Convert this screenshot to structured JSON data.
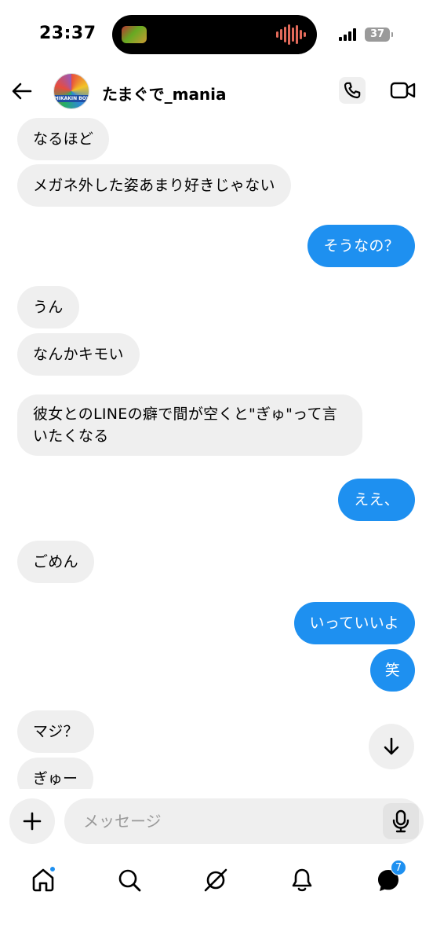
{
  "status_bar": {
    "time": "23:37",
    "battery": "37"
  },
  "header": {
    "username": "たまぐで_mania",
    "avatar_text": "HIKAKIN BOX",
    "icons": [
      "back-arrow-icon",
      "phone-icon",
      "video-camera-icon"
    ]
  },
  "messages": [
    {
      "from": "them",
      "text": "なるほど"
    },
    {
      "from": "them",
      "text": "メガネ外した姿あまり好きじゃない"
    },
    {
      "from": "me",
      "text": "そうなの？"
    },
    {
      "from": "them",
      "text": "うん"
    },
    {
      "from": "them",
      "text": "なんかキモい"
    },
    {
      "from": "them",
      "text": "彼女とのLINEの癖で間が空くと\"ぎゅ\"って言いたくなる"
    },
    {
      "from": "me",
      "text": "ええ、"
    },
    {
      "from": "them",
      "text": "ごめん"
    },
    {
      "from": "me",
      "text": "いっていいよ"
    },
    {
      "from": "me",
      "text": "笑"
    },
    {
      "from": "them",
      "text": "マジ？"
    },
    {
      "from": "them",
      "text": "ぎゅー"
    }
  ],
  "composer": {
    "placeholder": "メッセージ"
  },
  "nav": {
    "dm_badge": "7",
    "items": [
      "home-icon",
      "search-icon",
      "reels-icon",
      "notifications-icon",
      "messages-icon"
    ]
  },
  "colors": {
    "outgoing_bubble": "#1e90f0",
    "incoming_bubble": "#efefef",
    "accent": "#1e90f0"
  }
}
